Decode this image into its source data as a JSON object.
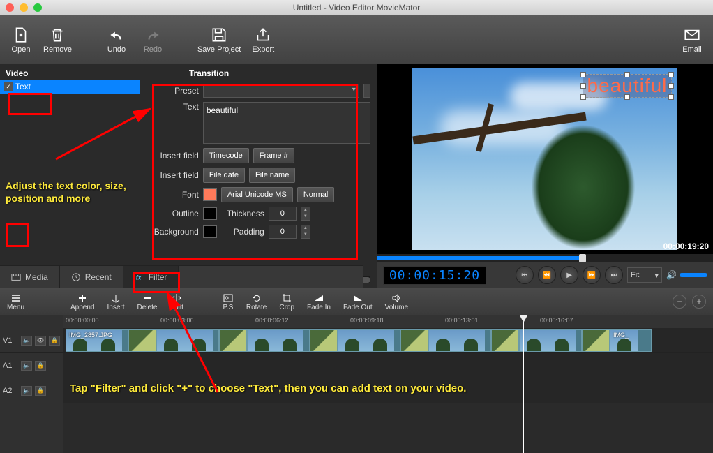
{
  "window": {
    "title": "Untitled - Video Editor MovieMator"
  },
  "toolbar": {
    "open": "Open",
    "remove": "Remove",
    "undo": "Undo",
    "redo": "Redo",
    "save": "Save Project",
    "export": "Export",
    "email": "Email"
  },
  "filterpanel": {
    "header": "Video",
    "selected": "Text",
    "plus": "+",
    "minus": "–"
  },
  "props": {
    "title": "Transition",
    "preset_label": "Preset",
    "text_label": "Text",
    "text_value": "beautiful",
    "insert1_label": "Insert field",
    "timecode_btn": "Timecode",
    "frame_btn": "Frame #",
    "insert2_label": "Insert field",
    "filedate_btn": "File date",
    "filename_btn": "File name",
    "font_label": "Font",
    "font_name": "Arial Unicode MS",
    "font_style": "Normal",
    "font_color": "#ff7a5a",
    "outline_label": "Outline",
    "outline_color": "#000000",
    "thickness_label": "Thickness",
    "thickness_val": "0",
    "background_label": "Background",
    "background_color": "#000000",
    "padding_label": "Padding",
    "padding_val": "0"
  },
  "preview": {
    "overlay_text": "beautiful",
    "duration_tc": "00:00:19:20",
    "position_tc": "00:00:15:20",
    "fit_label": "Fit"
  },
  "tabs": {
    "media": "Media",
    "recent": "Recent",
    "filter": "Filter"
  },
  "tlbar": {
    "menu": "Menu",
    "append": "Append",
    "insert": "Insert",
    "delete": "Delete",
    "split": "Split",
    "ps": "P.S",
    "rotate": "Rotate",
    "crop": "Crop",
    "fadein": "Fade In",
    "fadeout": "Fade Out",
    "volume": "Volume"
  },
  "ruler": [
    "00:00:00:00",
    "00:00:03:06",
    "00:00:06:12",
    "00:00:09:18",
    "00:00:13:01",
    "00:00:16:07"
  ],
  "tracks": {
    "v1": "V1",
    "a1": "A1",
    "a2": "A2"
  },
  "clips": {
    "label1": "IMG_2857.JPG",
    "label2": "IMG_"
  },
  "annotations": {
    "left": "Adjust the text color, size, position and more",
    "bottom": "Tap \"Filter\" and click \"+\" to choose \"Text\", then you can add text on your video."
  }
}
